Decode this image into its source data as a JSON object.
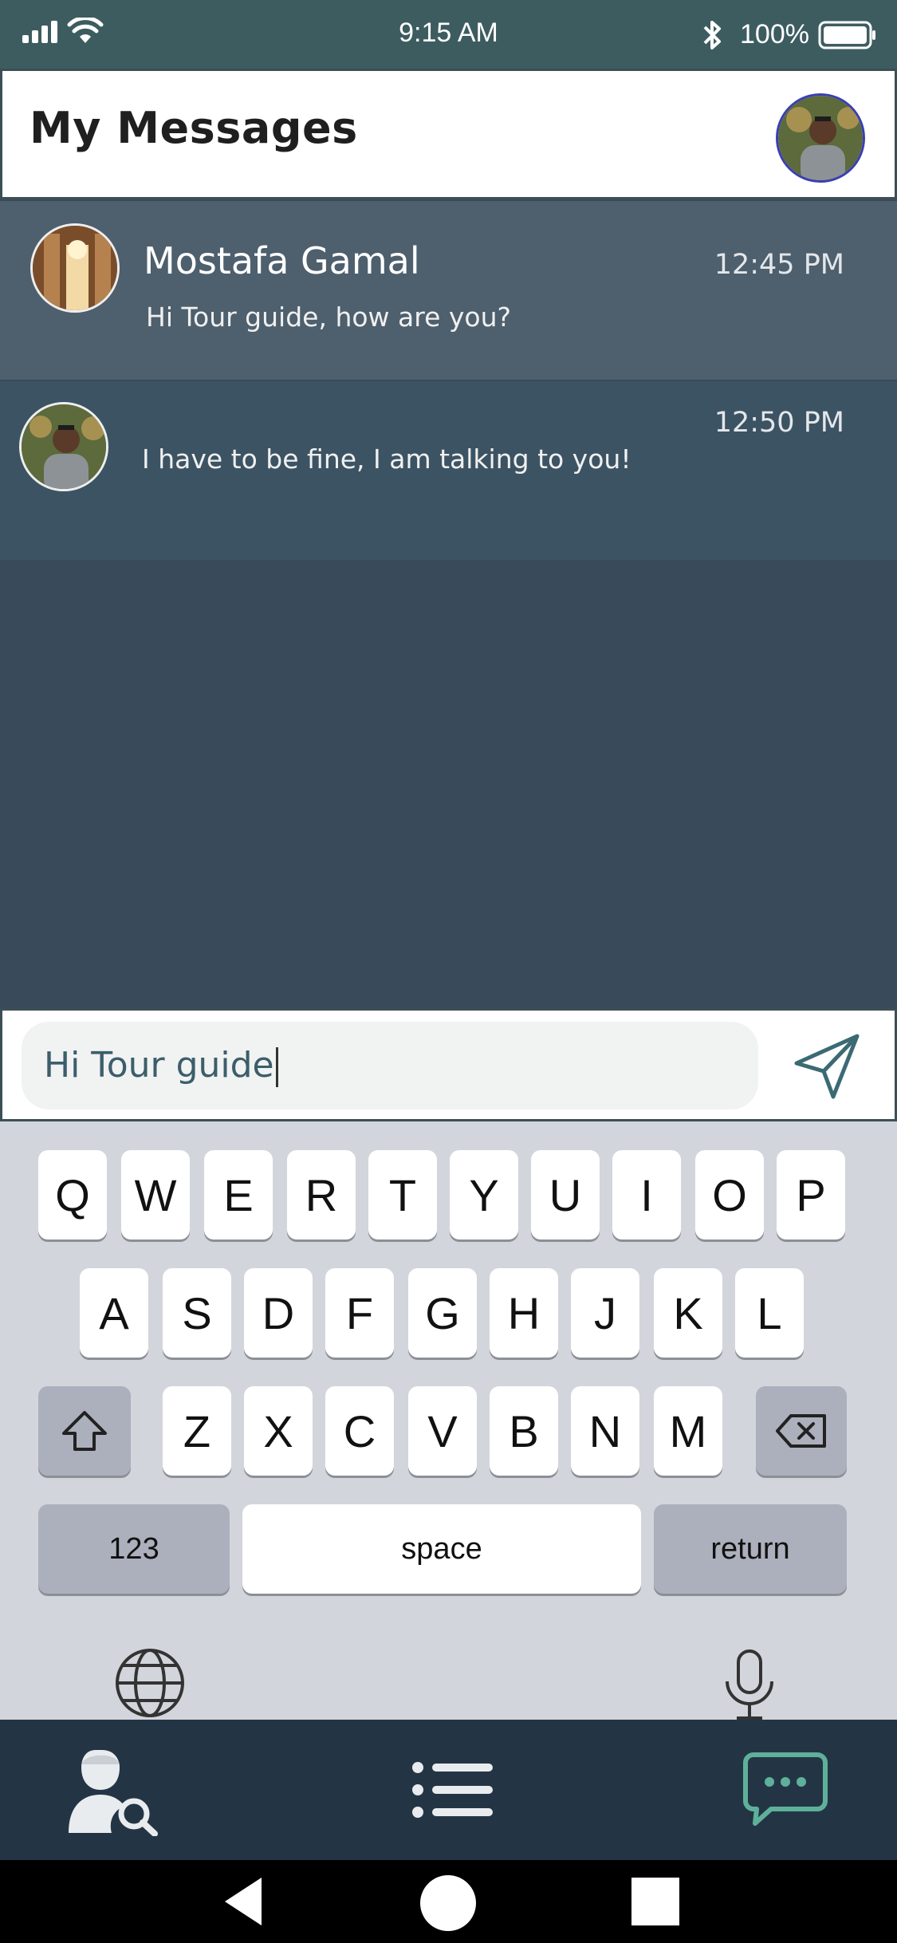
{
  "status_bar": {
    "time": "9:15 AM",
    "battery_percent": "100%",
    "icons": [
      "signal-icon",
      "wifi-icon",
      "bluetooth-icon",
      "battery-icon"
    ]
  },
  "header": {
    "title": "My Messages",
    "avatar": "profile-avatar"
  },
  "messages": [
    {
      "sender": "Mostafa Gamal",
      "text": "Hi Tour guide, how are you?",
      "time": "12:45 PM"
    },
    {
      "sender": "",
      "text": "I have to be fine, I am talking to you!",
      "time": "12:50 PM"
    }
  ],
  "composer": {
    "value": "Hi Tour guide",
    "send_icon": "send-icon"
  },
  "keyboard": {
    "row1": [
      "Q",
      "W",
      "E",
      "R",
      "T",
      "Y",
      "U",
      "I",
      "O",
      "P"
    ],
    "row2": [
      "A",
      "S",
      "D",
      "F",
      "G",
      "H",
      "J",
      "K",
      "L"
    ],
    "row3": [
      "Z",
      "X",
      "C",
      "V",
      "B",
      "N",
      "M"
    ],
    "numbers_label": "123",
    "space_label": "space",
    "return_label": "return"
  },
  "tab_bar": {
    "tabs": [
      "find-guide-icon",
      "list-icon",
      "chat-icon"
    ],
    "active_color": "#5fb09a"
  },
  "colors": {
    "status_bar": "#3d5c60",
    "background": "#394a5a",
    "tab_bar": "#233545"
  }
}
